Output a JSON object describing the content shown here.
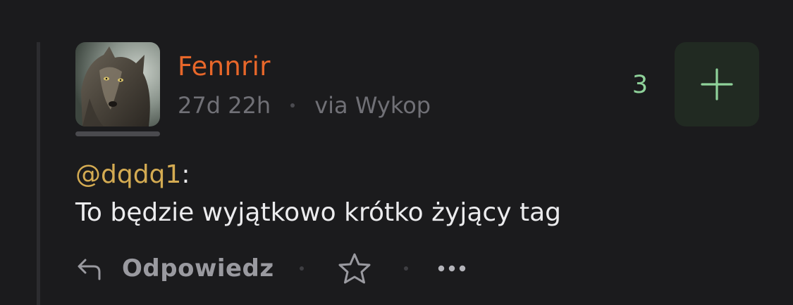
{
  "author": {
    "name": "Fennrir",
    "avatar_icon": "wolf-avatar",
    "color": "#e8672a"
  },
  "meta": {
    "time": "27d 22h",
    "via": "via Wykop"
  },
  "vote": {
    "count": "3",
    "button_icon": "plus-icon",
    "color": "#8fd29a"
  },
  "content": {
    "mention": "@dqdq1",
    "mention_suffix": ":",
    "text": "To będzie wyjątkowo krótko żyjący tag"
  },
  "actions": {
    "reply_icon": "reply-arrow-icon",
    "reply_label": "Odpowiedz",
    "favorite_icon": "star-icon",
    "more_icon": "more-dots-icon"
  }
}
